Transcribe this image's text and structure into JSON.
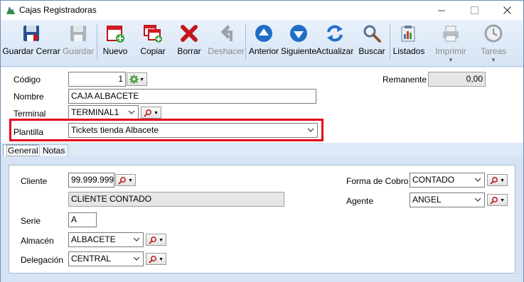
{
  "window": {
    "title": "Cajas Registradoras",
    "minimize_icon": "minimize-icon",
    "maximize_icon": "maximize-icon",
    "close_icon": "close-icon"
  },
  "toolbar": {
    "guardar_cerrar": "Guardar Cerrar",
    "guardar": "Guardar",
    "nuevo": "Nuevo",
    "copiar": "Copiar",
    "borrar": "Borrar",
    "deshacer": "Deshacer",
    "anterior": "Anterior",
    "siguiente": "Siguiente",
    "actualizar": "Actualizar",
    "buscar": "Buscar",
    "listados": "Listados",
    "imprimir": "Imprimir",
    "tareas": "Tareas"
  },
  "header": {
    "codigo_label": "Código",
    "codigo_value": "1",
    "remanente_label": "Remanente",
    "remanente_value": "0,00",
    "nombre_label": "Nombre",
    "nombre_value": "CAJA ALBACETE",
    "terminal_label": "Terminal",
    "terminal_value": "TERMINAL1",
    "plantilla_label": "Plantilla",
    "plantilla_value": "Tickets tienda Albacete"
  },
  "tabs": {
    "general": "General",
    "notas": "Notas"
  },
  "general": {
    "cliente_label": "Cliente",
    "cliente_value": "99.999.999",
    "cliente_nombre": "CLIENTE CONTADO",
    "serie_label": "Serie",
    "serie_value": "A",
    "almacen_label": "Almacén",
    "almacen_value": "ALBACETE",
    "delegacion_label": "Delegación",
    "delegacion_value": "CENTRAL",
    "forma_cobro_label": "Forma de Cobro",
    "forma_cobro_value": "CONTADO",
    "agente_label": "Agente",
    "agente_value": "ANGEL"
  },
  "colors": {
    "highlight": "#e3001b",
    "toolbar_bg": "#dde9f7",
    "panel_bg": "#d5e3f4"
  }
}
